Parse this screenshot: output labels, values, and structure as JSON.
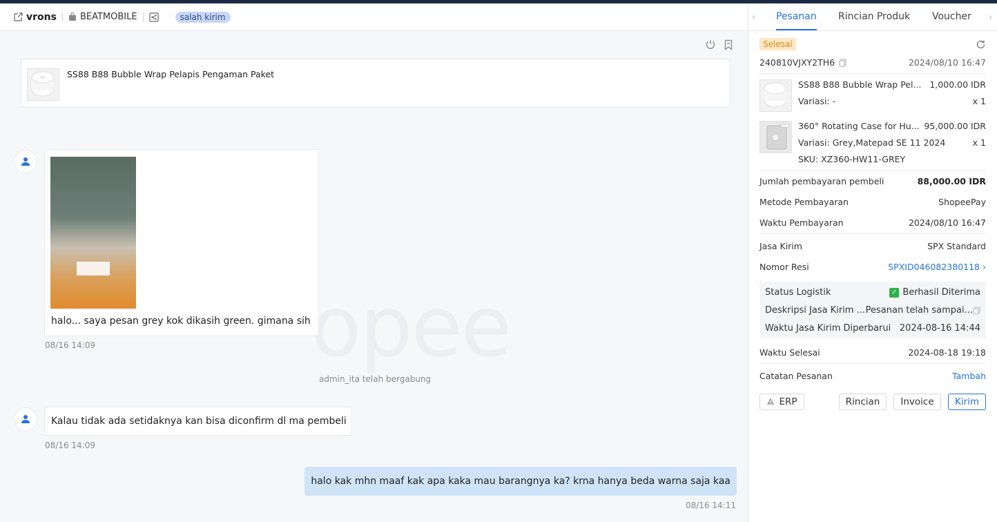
{
  "chat": {
    "header": {
      "username": "vrons",
      "shop": "BEATMOBILE",
      "tag": "salah kirim"
    },
    "watermark": "opee",
    "product_card": {
      "name": "SS88 B88 Bubble Wrap Pelapis Pengaman Paket"
    },
    "messages": [
      {
        "text": "halo... saya pesan grey kok dikasih green. gimana sih",
        "time": "08/16 14:09"
      },
      {
        "text": "Kalau tidak ada setidaknya kan bisa diconfirm dl ma pembeli",
        "time": "08/16 14:09"
      },
      {
        "text": "halo kak mhn maaf kak apa kaka mau barangnya ka?  krna hanya beda warna saja kaa",
        "time": "08/16 14:11"
      }
    ],
    "system_msg": "admin_ita telah bergabung"
  },
  "side": {
    "tabs": [
      "Pesanan",
      "Rincian Produk",
      "Voucher"
    ],
    "status": "Selesai",
    "order_id": "240810VJXY2TH6",
    "order_date": "2024/08/10 16:47",
    "items": [
      {
        "name": "SS88 B88 Bubble Wrap Pel...",
        "price": "1,000.00 IDR",
        "variant_label": "Variasi:",
        "variant": "-",
        "qty": "x 1"
      },
      {
        "name": "360° Rotating Case for Hu...",
        "price": "95,000.00 IDR",
        "variant_label": "Variasi:",
        "variant": "Grey,Matepad SE 11 2024",
        "qty": "x 1",
        "sku_label": "SKU:",
        "sku": "XZ360-HW11-GREY"
      }
    ],
    "fields": {
      "total_label": "Jumlah pembayaran pembeli",
      "total": "88,000.00 IDR",
      "method_label": "Metode Pembayaran",
      "method": "ShopeePay",
      "paytime_label": "Waktu Pembayaran",
      "paytime": "2024/08/10 16:47",
      "courier_label": "Jasa Kirim",
      "courier": "SPX Standard",
      "resi_label": "Nomor Resi",
      "resi": "SPXID046082380118",
      "logi_status_label": "Status Logistik",
      "logi_status": "Berhasil Diterima",
      "logi_desc_label": "Deskripsi Jasa Kirim ...",
      "logi_desc": "Pesanan telah sampai...",
      "logi_update_label": "Waktu Jasa Kirim Diperbarui",
      "logi_update": "2024-08-16 14:44",
      "done_label": "Waktu Selesai",
      "done": "2024-08-18 19:18",
      "note_label": "Catatan Pesanan",
      "note_action": "Tambah"
    },
    "buttons": {
      "erp": "ERP",
      "rincian": "Rincian",
      "invoice": "Invoice",
      "kirim": "Kirim"
    },
    "colors": {
      "accent": "#2673dd",
      "status_bg": "#fde8c6",
      "success": "#2bb34a"
    }
  }
}
